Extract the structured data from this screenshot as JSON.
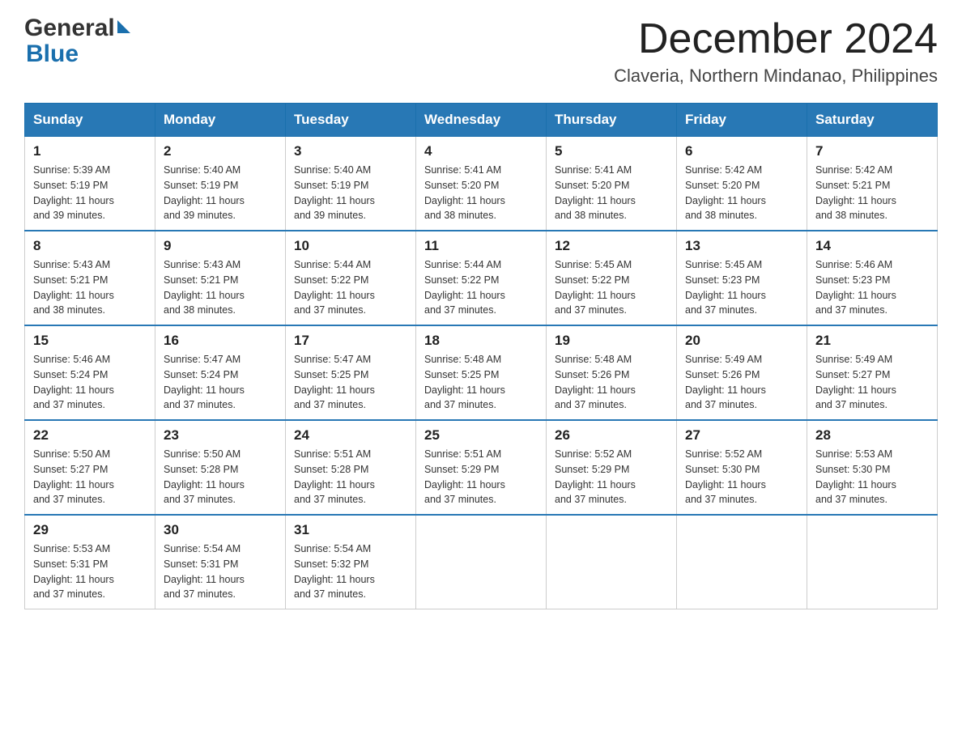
{
  "logo": {
    "text_general": "General",
    "text_blue": "Blue",
    "triangle": true
  },
  "header": {
    "month_year": "December 2024",
    "location": "Claveria, Northern Mindanao, Philippines"
  },
  "weekdays": [
    "Sunday",
    "Monday",
    "Tuesday",
    "Wednesday",
    "Thursday",
    "Friday",
    "Saturday"
  ],
  "weeks": [
    [
      {
        "day": "1",
        "sunrise": "5:39 AM",
        "sunset": "5:19 PM",
        "daylight": "11 hours and 39 minutes."
      },
      {
        "day": "2",
        "sunrise": "5:40 AM",
        "sunset": "5:19 PM",
        "daylight": "11 hours and 39 minutes."
      },
      {
        "day": "3",
        "sunrise": "5:40 AM",
        "sunset": "5:19 PM",
        "daylight": "11 hours and 39 minutes."
      },
      {
        "day": "4",
        "sunrise": "5:41 AM",
        "sunset": "5:20 PM",
        "daylight": "11 hours and 38 minutes."
      },
      {
        "day": "5",
        "sunrise": "5:41 AM",
        "sunset": "5:20 PM",
        "daylight": "11 hours and 38 minutes."
      },
      {
        "day": "6",
        "sunrise": "5:42 AM",
        "sunset": "5:20 PM",
        "daylight": "11 hours and 38 minutes."
      },
      {
        "day": "7",
        "sunrise": "5:42 AM",
        "sunset": "5:21 PM",
        "daylight": "11 hours and 38 minutes."
      }
    ],
    [
      {
        "day": "8",
        "sunrise": "5:43 AM",
        "sunset": "5:21 PM",
        "daylight": "11 hours and 38 minutes."
      },
      {
        "day": "9",
        "sunrise": "5:43 AM",
        "sunset": "5:21 PM",
        "daylight": "11 hours and 38 minutes."
      },
      {
        "day": "10",
        "sunrise": "5:44 AM",
        "sunset": "5:22 PM",
        "daylight": "11 hours and 37 minutes."
      },
      {
        "day": "11",
        "sunrise": "5:44 AM",
        "sunset": "5:22 PM",
        "daylight": "11 hours and 37 minutes."
      },
      {
        "day": "12",
        "sunrise": "5:45 AM",
        "sunset": "5:22 PM",
        "daylight": "11 hours and 37 minutes."
      },
      {
        "day": "13",
        "sunrise": "5:45 AM",
        "sunset": "5:23 PM",
        "daylight": "11 hours and 37 minutes."
      },
      {
        "day": "14",
        "sunrise": "5:46 AM",
        "sunset": "5:23 PM",
        "daylight": "11 hours and 37 minutes."
      }
    ],
    [
      {
        "day": "15",
        "sunrise": "5:46 AM",
        "sunset": "5:24 PM",
        "daylight": "11 hours and 37 minutes."
      },
      {
        "day": "16",
        "sunrise": "5:47 AM",
        "sunset": "5:24 PM",
        "daylight": "11 hours and 37 minutes."
      },
      {
        "day": "17",
        "sunrise": "5:47 AM",
        "sunset": "5:25 PM",
        "daylight": "11 hours and 37 minutes."
      },
      {
        "day": "18",
        "sunrise": "5:48 AM",
        "sunset": "5:25 PM",
        "daylight": "11 hours and 37 minutes."
      },
      {
        "day": "19",
        "sunrise": "5:48 AM",
        "sunset": "5:26 PM",
        "daylight": "11 hours and 37 minutes."
      },
      {
        "day": "20",
        "sunrise": "5:49 AM",
        "sunset": "5:26 PM",
        "daylight": "11 hours and 37 minutes."
      },
      {
        "day": "21",
        "sunrise": "5:49 AM",
        "sunset": "5:27 PM",
        "daylight": "11 hours and 37 minutes."
      }
    ],
    [
      {
        "day": "22",
        "sunrise": "5:50 AM",
        "sunset": "5:27 PM",
        "daylight": "11 hours and 37 minutes."
      },
      {
        "day": "23",
        "sunrise": "5:50 AM",
        "sunset": "5:28 PM",
        "daylight": "11 hours and 37 minutes."
      },
      {
        "day": "24",
        "sunrise": "5:51 AM",
        "sunset": "5:28 PM",
        "daylight": "11 hours and 37 minutes."
      },
      {
        "day": "25",
        "sunrise": "5:51 AM",
        "sunset": "5:29 PM",
        "daylight": "11 hours and 37 minutes."
      },
      {
        "day": "26",
        "sunrise": "5:52 AM",
        "sunset": "5:29 PM",
        "daylight": "11 hours and 37 minutes."
      },
      {
        "day": "27",
        "sunrise": "5:52 AM",
        "sunset": "5:30 PM",
        "daylight": "11 hours and 37 minutes."
      },
      {
        "day": "28",
        "sunrise": "5:53 AM",
        "sunset": "5:30 PM",
        "daylight": "11 hours and 37 minutes."
      }
    ],
    [
      {
        "day": "29",
        "sunrise": "5:53 AM",
        "sunset": "5:31 PM",
        "daylight": "11 hours and 37 minutes."
      },
      {
        "day": "30",
        "sunrise": "5:54 AM",
        "sunset": "5:31 PM",
        "daylight": "11 hours and 37 minutes."
      },
      {
        "day": "31",
        "sunrise": "5:54 AM",
        "sunset": "5:32 PM",
        "daylight": "11 hours and 37 minutes."
      },
      null,
      null,
      null,
      null
    ]
  ],
  "labels": {
    "sunrise": "Sunrise:",
    "sunset": "Sunset:",
    "daylight": "Daylight:"
  }
}
